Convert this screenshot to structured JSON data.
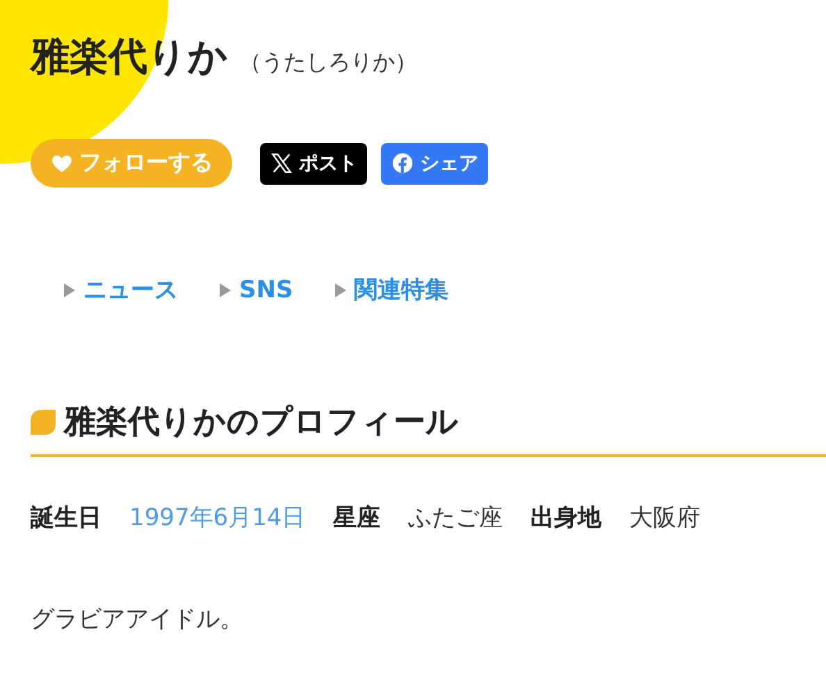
{
  "name": "雅楽代りか",
  "reading": "（うたしろりか）",
  "actions": [
    {
      "kind": "follow",
      "label": "フォローする"
    },
    {
      "kind": "x",
      "label": "ポスト"
    },
    {
      "kind": "facebook",
      "label": "シェア"
    }
  ],
  "nav": [
    "ニュース",
    "SNS",
    "関連特集"
  ],
  "profile": {
    "heading": "雅楽代りかのプロフィール",
    "fields": [
      {
        "label": "誕生日",
        "value": "1997年6月14日",
        "kind": "link"
      },
      {
        "label": "星座",
        "value": "ふたご座",
        "kind": "text"
      },
      {
        "label": "出身地",
        "value": "大阪府",
        "kind": "text"
      }
    ],
    "description": "グラビアアイドル。"
  }
}
